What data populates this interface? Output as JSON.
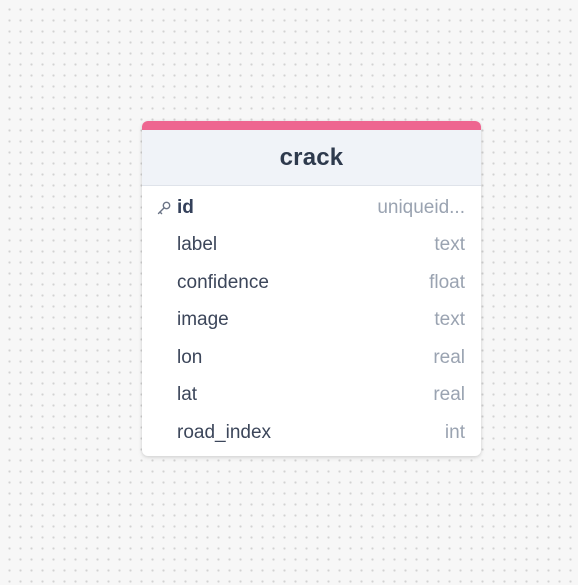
{
  "table": {
    "name": "crack",
    "accent_color": "#ee6690",
    "columns": [
      {
        "name": "id",
        "type": "uniqueid...",
        "primary_key": true,
        "icon": "key-icon"
      },
      {
        "name": "label",
        "type": "text"
      },
      {
        "name": "confidence",
        "type": "float"
      },
      {
        "name": "image",
        "type": "text"
      },
      {
        "name": "lon",
        "type": "real"
      },
      {
        "name": "lat",
        "type": "real"
      },
      {
        "name": "road_index",
        "type": "int"
      }
    ]
  }
}
